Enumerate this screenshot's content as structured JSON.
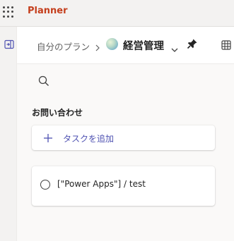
{
  "app": {
    "title": "Planner"
  },
  "header": {
    "breadcrumb_root": "自分のプラン",
    "plan_title": "経営管理"
  },
  "bucket": {
    "title": "お問い合わせ",
    "add_task_label": "タスクを追加",
    "tasks": [
      {
        "title": "[\"Power Apps\"] / test"
      }
    ]
  },
  "colors": {
    "brand": "#c43e1c",
    "accent": "#4f52b2"
  },
  "icons": [
    "app-launcher-icon",
    "expand-pane-icon",
    "chevron-right-icon",
    "plan-icon",
    "chevron-down-icon",
    "pin-icon",
    "grid-icon",
    "search-icon",
    "plus-icon",
    "circle-check-icon"
  ]
}
